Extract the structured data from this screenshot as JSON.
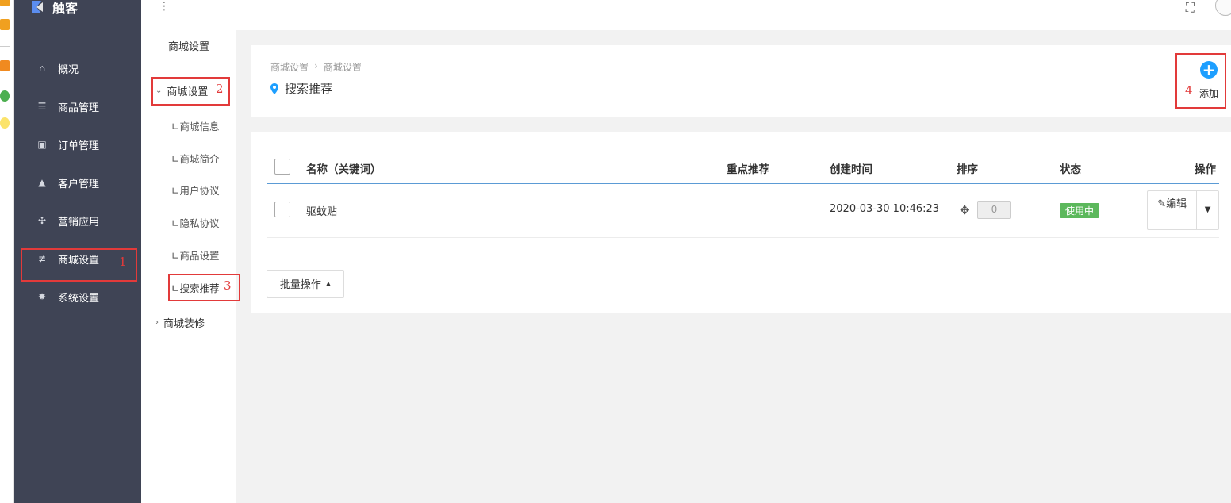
{
  "brand": {
    "name": "触客"
  },
  "sidebar": {
    "items": [
      {
        "label": "概况",
        "icon": "home-icon"
      },
      {
        "label": "商品管理",
        "icon": "list-icon"
      },
      {
        "label": "订单管理",
        "icon": "clipboard-icon"
      },
      {
        "label": "客户管理",
        "icon": "user-icon"
      },
      {
        "label": "营销应用",
        "icon": "puzzle-icon"
      },
      {
        "label": "商城设置",
        "icon": "store-icon"
      },
      {
        "label": "系统设置",
        "icon": "gear-icon"
      }
    ]
  },
  "subnav": {
    "title": "商城设置",
    "group_open": "商城设置",
    "items": [
      "∟商城信息",
      "∟商城简介",
      "∟用户协议",
      "∟隐私协议",
      "∟商品设置",
      "∟搜索推荐"
    ],
    "group_closed": "商城装修"
  },
  "annotations": {
    "n1": "1",
    "n2": "2",
    "n3": "3",
    "n4": "4"
  },
  "breadcrumb": [
    "商城设置",
    "商城设置"
  ],
  "page_title": "搜索推荐",
  "add_button": {
    "label": "添加"
  },
  "table": {
    "headers": [
      "名称（关键词）",
      "重点推荐",
      "创建时间",
      "排序",
      "状态",
      "操作"
    ],
    "rows": [
      {
        "name": "驱蚊贴",
        "featured": "",
        "created": "2020-03-30 10:46:23",
        "sort": "0",
        "status": "使用中",
        "edit_label": "编辑"
      }
    ]
  },
  "batch_button": {
    "label": "批量操作"
  },
  "colors": {
    "sidebar_bg": "#3f4455",
    "accent": "#1e9fff",
    "status_green": "#5cb85c",
    "annotation_red": "#e23a3a"
  }
}
